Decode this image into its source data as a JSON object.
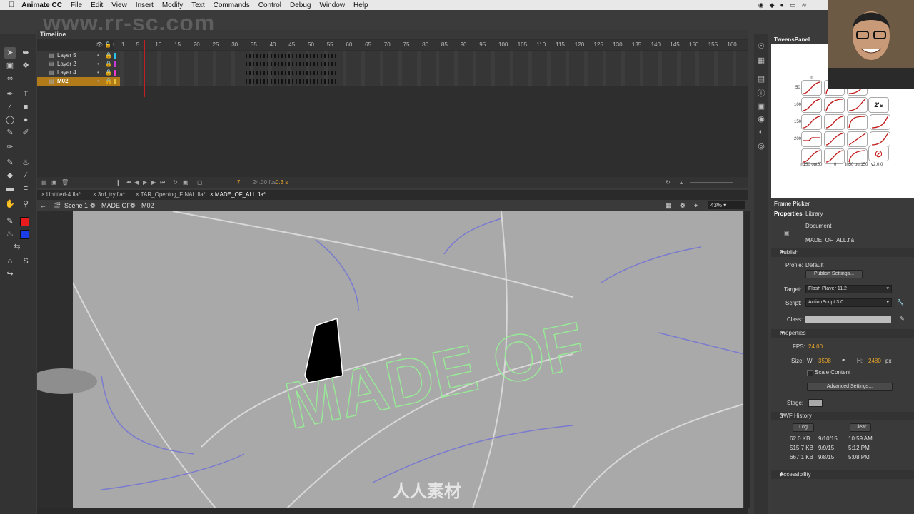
{
  "menubar": {
    "app": "Animate CC",
    "items": [
      "File",
      "Edit",
      "View",
      "Insert",
      "Modify",
      "Text",
      "Commands",
      "Control",
      "Debug",
      "Window",
      "Help"
    ]
  },
  "watermark": "www.rr-sc.com",
  "timeline": {
    "title": "Timeline",
    "ruler": [
      "1",
      "5",
      "10",
      "15",
      "20",
      "25",
      "30",
      "35",
      "40",
      "45",
      "50",
      "55",
      "60",
      "65",
      "70",
      "75",
      "80",
      "85",
      "90",
      "95",
      "100",
      "105",
      "110",
      "115",
      "120",
      "125",
      "130",
      "135",
      "140",
      "145",
      "150",
      "155",
      "160"
    ],
    "layers": [
      {
        "name": "Layer 5",
        "color": "#2ac4e8"
      },
      {
        "name": "Layer 2",
        "color": "#c43bd8"
      },
      {
        "name": "Layer 4",
        "color": "#e83bc8"
      },
      {
        "name": "M02",
        "color": "#e8c43b"
      }
    ],
    "footer": {
      "frame": "7",
      "fps": "24.00 fps",
      "time": "0.3 s"
    }
  },
  "tabs": [
    "Untitled-4.fla*",
    "3rd_try.fla*",
    "TAR_Opening_FINAL.fla*",
    "MADE_OF_ALL.fla*"
  ],
  "breadcrumbs": [
    "Scene 1",
    "MADE OF",
    "M02"
  ],
  "zoom": "43%",
  "stage": {
    "text": "MADE OF"
  },
  "tweens": {
    "title": "TweensPanel",
    "row_labels": [
      "50",
      "100",
      "150",
      "200"
    ],
    "col_label": "in",
    "special": "2's",
    "bottom_labels": [
      "in150 out50",
      "0",
      "in50 out150",
      "v2.0.0"
    ]
  },
  "properties": {
    "frame_picker": "Frame Picker",
    "tabs": [
      "Properties",
      "Library"
    ],
    "doc_label": "Document",
    "doc_name": "MADE_OF_ALL.fla",
    "publish_header": "Publish",
    "profile_label": "Profile:",
    "profile_value": "Default",
    "publish_settings": "Publish Settings...",
    "target_label": "Target:",
    "target_value": "Flash Player 11.2",
    "script_label": "Script:",
    "script_value": "ActionScript 3.0",
    "class_label": "Class:",
    "properties_header": "Properties",
    "fps_label": "FPS:",
    "fps_value": "24.00",
    "size_label": "Size:",
    "w_label": "W:",
    "w_value": "3508",
    "h_label": "H:",
    "h_value": "2480",
    "px": "px",
    "scale_content": "Scale Content",
    "advanced_settings": "Advanced Settings...",
    "stage_label": "Stage:",
    "swf_header": "SWF History",
    "log_btn": "Log",
    "clear_btn": "Clear",
    "history": [
      {
        "size": "62.0 KB",
        "date": "9/10/15",
        "time": "10:59 AM"
      },
      {
        "size": "515.7 KB",
        "date": "9/9/15",
        "time": "5:12 PM"
      },
      {
        "size": "667.1 KB",
        "date": "9/8/15",
        "time": "5:08 PM"
      }
    ],
    "accessibility": "Accessibility"
  },
  "bottom_logo": "人人素材",
  "colors": {
    "stroke": "#e81c1c",
    "fill": "#1c3ce8",
    "layer_selected": "#b07b18"
  }
}
